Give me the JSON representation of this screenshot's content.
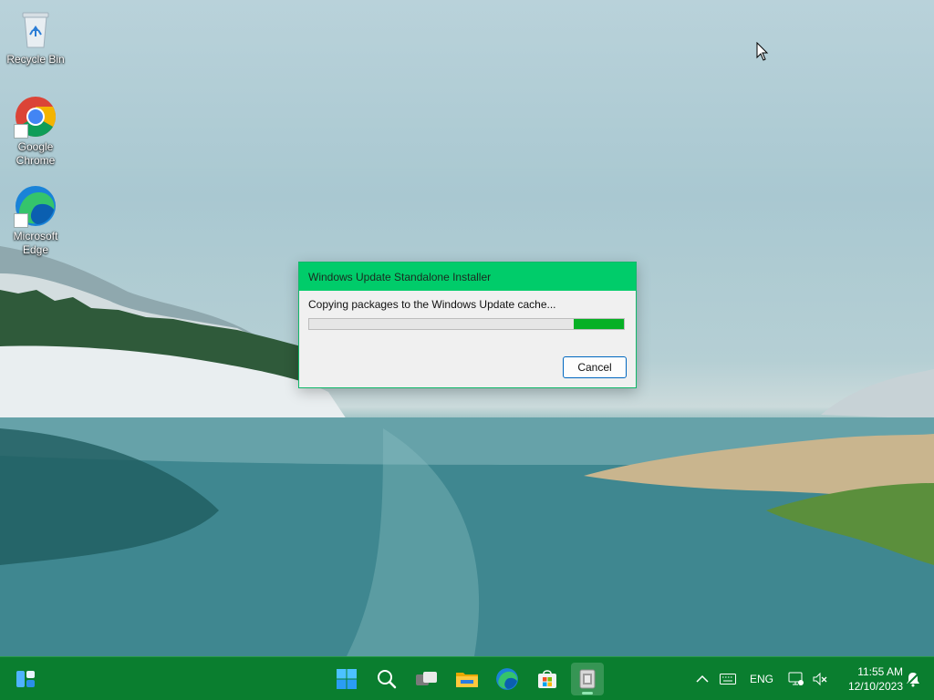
{
  "desktop": {
    "icons": [
      {
        "label": "Recycle Bin"
      },
      {
        "label": "Google\nChrome"
      },
      {
        "label": "Microsoft\nEdge"
      }
    ]
  },
  "dialog": {
    "title": "Windows Update Standalone Installer",
    "status": "Copying packages to the Windows Update cache...",
    "progress_segment": {
      "start_fraction": 0.84,
      "end_fraction": 1.0
    },
    "cancel_label": "Cancel",
    "accent_color": "#00cc6a",
    "progress_color": "#06b025"
  },
  "taskbar": {
    "color": "#0a7e2f",
    "apps": [
      {
        "name": "start-icon"
      },
      {
        "name": "search-icon"
      },
      {
        "name": "task-view-icon"
      },
      {
        "name": "file-explorer-icon"
      },
      {
        "name": "edge-icon"
      },
      {
        "name": "microsoft-store-icon"
      },
      {
        "name": "installer-icon",
        "active": true
      }
    ],
    "widgets_icon": "widgets-icon",
    "tray": {
      "language": "ENG",
      "time": "11:55 AM",
      "date": "12/10/2023"
    }
  }
}
